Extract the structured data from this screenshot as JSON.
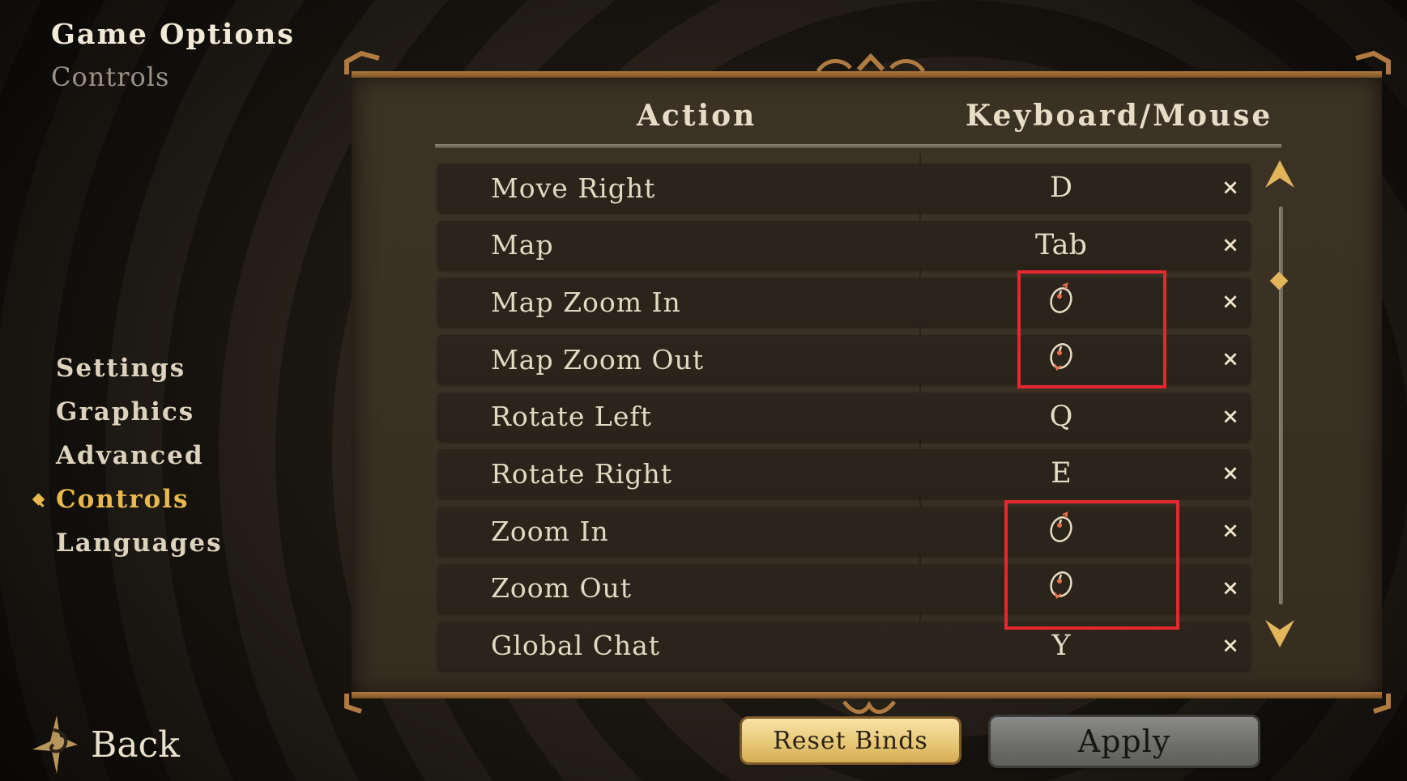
{
  "header": {
    "title": "Game Options",
    "subtitle": "Controls"
  },
  "nav": {
    "items": [
      {
        "label": "Settings",
        "active": false
      },
      {
        "label": "Graphics",
        "active": false
      },
      {
        "label": "Advanced",
        "active": false
      },
      {
        "label": "Controls",
        "active": true
      },
      {
        "label": "Languages",
        "active": false
      }
    ]
  },
  "back": {
    "label": "Back",
    "icon": "back-arrow-icon"
  },
  "table": {
    "col_action": "Action",
    "col_binding": "Keyboard/Mouse",
    "clear_glyph": "×",
    "rows": [
      {
        "action": "Move Right",
        "binding": "D"
      },
      {
        "action": "Map",
        "binding": "Tab"
      },
      {
        "action": "Map Zoom In",
        "binding": "",
        "icon": "mouse-scroll-up-icon"
      },
      {
        "action": "Map Zoom Out",
        "binding": "",
        "icon": "mouse-scroll-down-icon"
      },
      {
        "action": "Rotate Left",
        "binding": "Q"
      },
      {
        "action": "Rotate Right",
        "binding": "E"
      },
      {
        "action": "Zoom In",
        "binding": "",
        "icon": "mouse-scroll-up-icon"
      },
      {
        "action": "Zoom Out",
        "binding": "",
        "icon": "mouse-scroll-down-icon"
      },
      {
        "action": "Global Chat",
        "binding": "Y"
      }
    ]
  },
  "buttons": {
    "reset": "Reset Binds",
    "apply": "Apply"
  },
  "colors": {
    "accent_gold": "#e9b94e",
    "highlight_red": "#e8262f",
    "panel_bg": "#3a3023"
  }
}
